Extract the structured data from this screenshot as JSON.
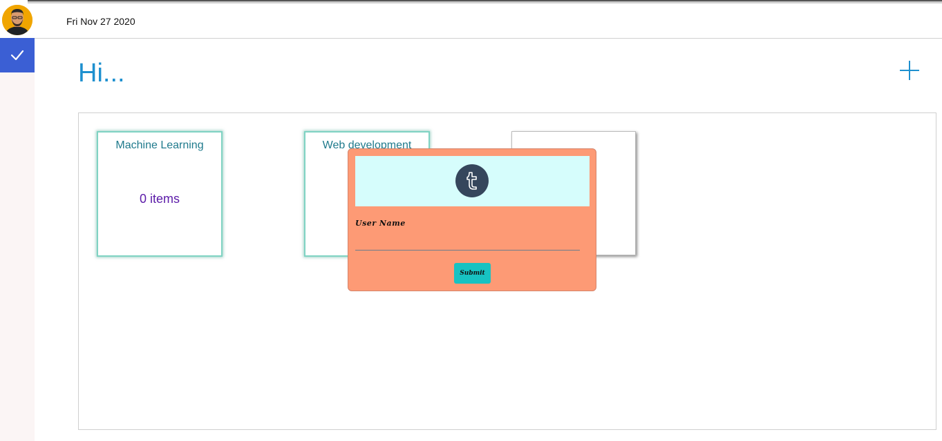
{
  "header": {
    "date": "Fri Nov 27 2020"
  },
  "main": {
    "greeting": "Hi..."
  },
  "boards": [
    {
      "title": "Machine Learning",
      "count": "0 items"
    },
    {
      "title": "Web development",
      "count": ""
    },
    {
      "title": "",
      "count": ""
    }
  ],
  "login_modal": {
    "user_label": "User Name",
    "user_value": "",
    "submit_label": "Submit"
  },
  "colors": {
    "accent_blue": "#1e90cf",
    "sidebar_active": "#3b5fd4",
    "modal_bg": "#fd9a75",
    "modal_banner": "#d6fdfc",
    "submit_bg": "#17c2c2",
    "tumblr": "#35465c"
  },
  "icons": {
    "avatar": "user-avatar",
    "sidebar_check": "check-icon",
    "add": "plus-icon",
    "logo": "tumblr-logo"
  }
}
